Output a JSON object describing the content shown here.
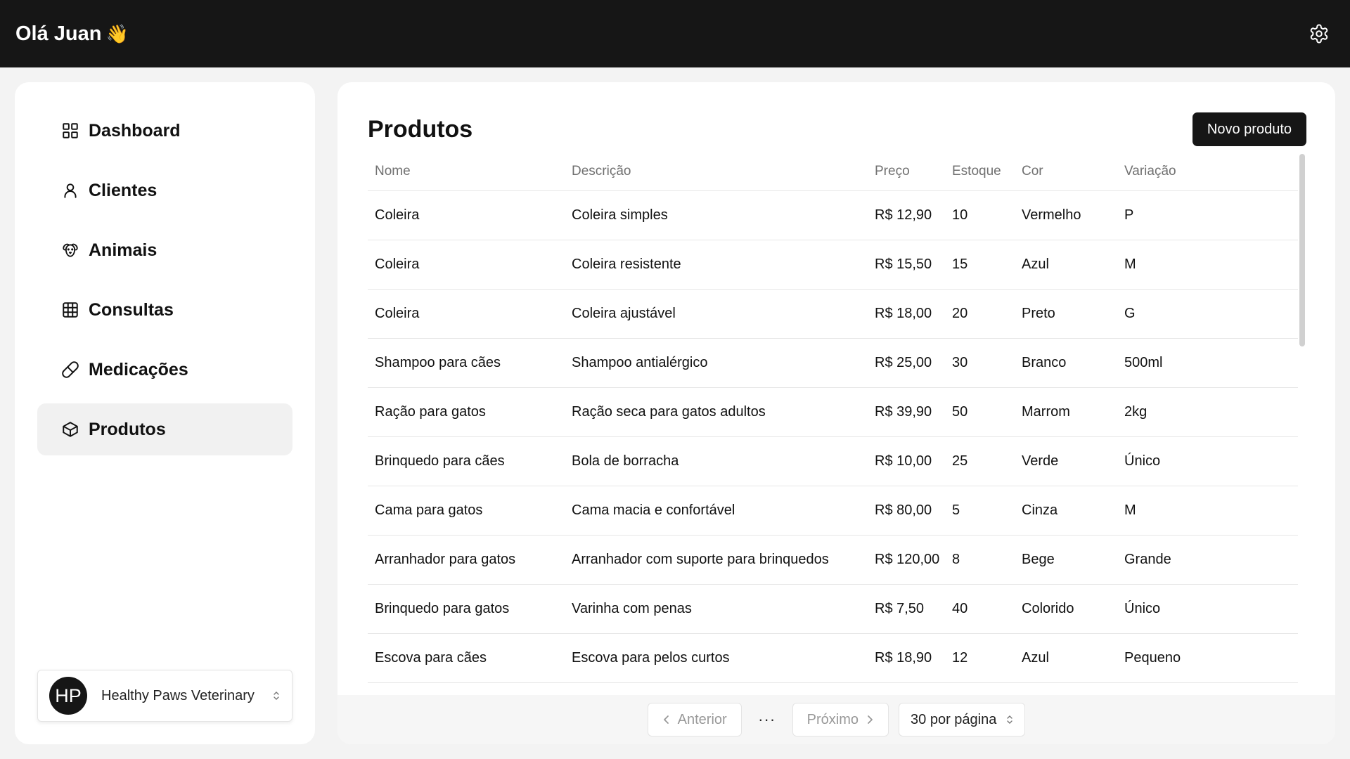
{
  "header": {
    "greeting": "Olá Juan",
    "wave_emoji": "👋",
    "settings_icon": "gear-icon"
  },
  "sidebar": {
    "items": [
      {
        "label": "Dashboard",
        "icon": "grid-icon",
        "active": false
      },
      {
        "label": "Clientes",
        "icon": "user-icon",
        "active": false
      },
      {
        "label": "Animais",
        "icon": "dog-icon",
        "active": false
      },
      {
        "label": "Consultas",
        "icon": "calendar-grid-icon",
        "active": false
      },
      {
        "label": "Medicações",
        "icon": "pill-icon",
        "active": false
      },
      {
        "label": "Produtos",
        "icon": "box-icon",
        "active": true
      }
    ],
    "clinic": {
      "initials": "HP",
      "name": "Healthy Paws Veterinary"
    }
  },
  "main": {
    "title": "Produtos",
    "new_button": "Novo produto",
    "columns": [
      "Nome",
      "Descrição",
      "Preço",
      "Estoque",
      "Cor",
      "Variação"
    ],
    "rows": [
      [
        "Coleira",
        "Coleira simples",
        "R$ 12,90",
        "10",
        "Vermelho",
        "P"
      ],
      [
        "Coleira",
        "Coleira resistente",
        "R$ 15,50",
        "15",
        "Azul",
        "M"
      ],
      [
        "Coleira",
        "Coleira ajustável",
        "R$ 18,00",
        "20",
        "Preto",
        "G"
      ],
      [
        "Shampoo para cães",
        "Shampoo antialérgico",
        "R$ 25,00",
        "30",
        "Branco",
        "500ml"
      ],
      [
        "Ração para gatos",
        "Ração seca para gatos adultos",
        "R$ 39,90",
        "50",
        "Marrom",
        "2kg"
      ],
      [
        "Brinquedo para cães",
        "Bola de borracha",
        "R$ 10,00",
        "25",
        "Verde",
        "Único"
      ],
      [
        "Cama para gatos",
        "Cama macia e confortável",
        "R$ 80,00",
        "5",
        "Cinza",
        "M"
      ],
      [
        "Arranhador para gatos",
        "Arranhador com suporte para brinquedos",
        "R$ 120,00",
        "8",
        "Bege",
        "Grande"
      ],
      [
        "Brinquedo para gatos",
        "Varinha com penas",
        "R$ 7,50",
        "40",
        "Colorido",
        "Único"
      ],
      [
        "Escova para cães",
        "Escova para pelos curtos",
        "R$ 18,90",
        "12",
        "Azul",
        "Pequeno"
      ]
    ]
  },
  "pagination": {
    "previous": "Anterior",
    "ellipsis": "···",
    "next": "Próximo",
    "per_page": "30 por página"
  }
}
